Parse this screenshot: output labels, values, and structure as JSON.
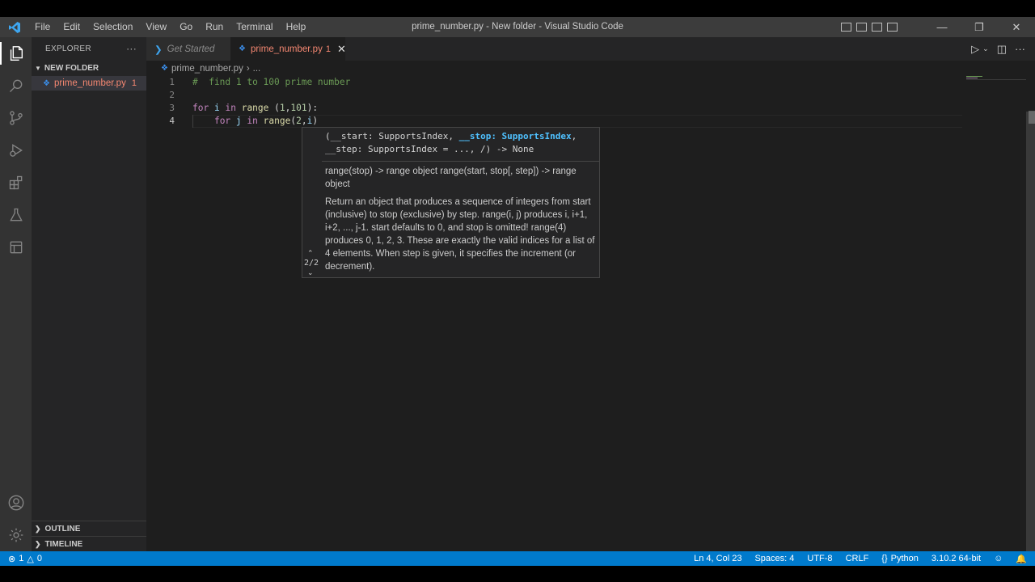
{
  "window": {
    "title": "prime_number.py - New folder - Visual Studio Code",
    "menu": [
      "File",
      "Edit",
      "Selection",
      "View",
      "Go",
      "Run",
      "Terminal",
      "Help"
    ]
  },
  "sidebar": {
    "header": "EXPLORER",
    "more": "···",
    "folder": "NEW FOLDER",
    "files": [
      {
        "name": "prime_number.py",
        "problems": "1"
      }
    ],
    "outline": "OUTLINE",
    "timeline": "TIMELINE"
  },
  "tabs": [
    {
      "label": "Get Started",
      "active": false
    },
    {
      "label": "prime_number.py",
      "active": true,
      "problems": "1"
    }
  ],
  "breadcrumb": {
    "file": "prime_number.py",
    "rest": "..."
  },
  "editor": {
    "lines": [
      {
        "number": "1",
        "tokens": [
          [
            "comment",
            "#  find 1 to 100 prime number"
          ]
        ]
      },
      {
        "number": "2",
        "tokens": []
      },
      {
        "number": "3",
        "tokens": [
          [
            "kw",
            "for"
          ],
          [
            "punc",
            " "
          ],
          [
            "var",
            "i"
          ],
          [
            "punc",
            " "
          ],
          [
            "kw",
            "in"
          ],
          [
            "punc",
            " "
          ],
          [
            "fn",
            "range"
          ],
          [
            "punc",
            " ("
          ],
          [
            "num",
            "1"
          ],
          [
            "punc",
            ","
          ],
          [
            "num",
            "101"
          ],
          [
            "punc",
            "):"
          ]
        ]
      },
      {
        "number": "4",
        "tokens": [
          [
            "punc",
            "    "
          ],
          [
            "kw",
            "for"
          ],
          [
            "punc",
            " "
          ],
          [
            "var",
            "j"
          ],
          [
            "punc",
            " "
          ],
          [
            "kw",
            "in"
          ],
          [
            "punc",
            " "
          ],
          [
            "fn",
            "range"
          ],
          [
            "punc",
            "("
          ],
          [
            "num",
            "2"
          ],
          [
            "punc",
            ","
          ],
          [
            "var",
            "i"
          ],
          [
            "punc",
            ")"
          ]
        ]
      }
    ],
    "current_line": "4"
  },
  "signature_help": {
    "signature_pre": "(__start: SupportsIndex, ",
    "active_param": "__stop: SupportsIndex",
    "signature_post": ",\n__step: SupportsIndex = ..., /) -> None",
    "doc_summary": "range(stop) -> range object range(start, stop[, step]) -> range object",
    "doc_body": "Return an object that produces a sequence of integers from start (inclusive) to stop (exclusive) by step. range(i, j) produces i, i+1, i+2, ..., j-1. start defaults to 0, and stop is omitted! range(4) produces 0, 1, 2, 3. These are exactly the valid indices for a list of 4 elements. When step is given, it specifies the increment (or decrement).",
    "overload_index": "2/2"
  },
  "statusbar": {
    "errors": "1",
    "warnings": "0",
    "position": "Ln 4, Col 23",
    "spaces": "Spaces: 4",
    "encoding": "UTF-8",
    "eol": "CRLF",
    "language": "Python",
    "interpreter": "3.10.2 64-bit"
  },
  "colors": {
    "statusbar": "#007acc",
    "error_file": "#f48771",
    "comment": "#6a9955",
    "keyword": "#c586c0"
  }
}
